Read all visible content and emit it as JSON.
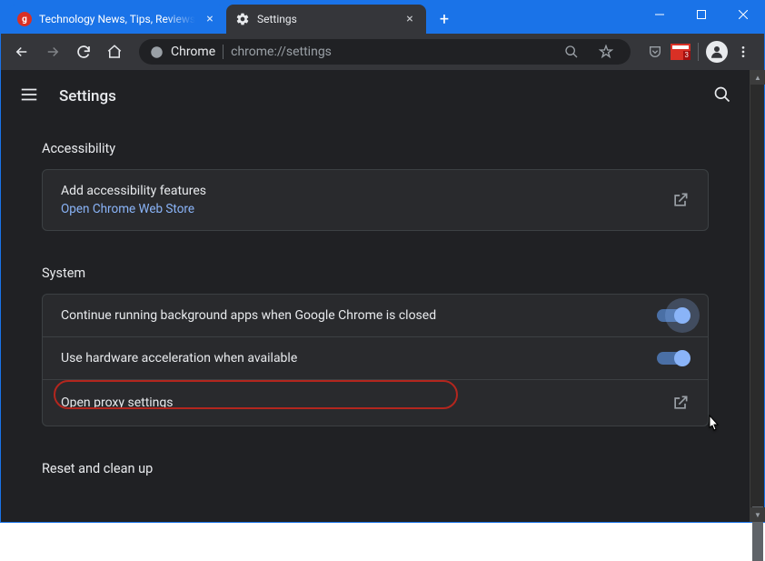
{
  "tabs": [
    {
      "title": "Technology News, Tips, Reviews,",
      "favicon": "g"
    },
    {
      "title": "Settings",
      "favicon": "gear"
    }
  ],
  "toolbar": {
    "chrome_label": "Chrome",
    "url": "chrome://settings",
    "ext_badge": "3"
  },
  "header": {
    "title": "Settings"
  },
  "sections": {
    "accessibility": {
      "title": "Accessibility",
      "item_label": "Add accessibility features",
      "item_sub": "Open Chrome Web Store"
    },
    "system": {
      "title": "System",
      "bg_apps": "Continue running background apps when Google Chrome is closed",
      "hw_accel": "Use hardware acceleration when available",
      "proxy": "Open proxy settings"
    },
    "reset": {
      "title": "Reset and clean up"
    }
  }
}
